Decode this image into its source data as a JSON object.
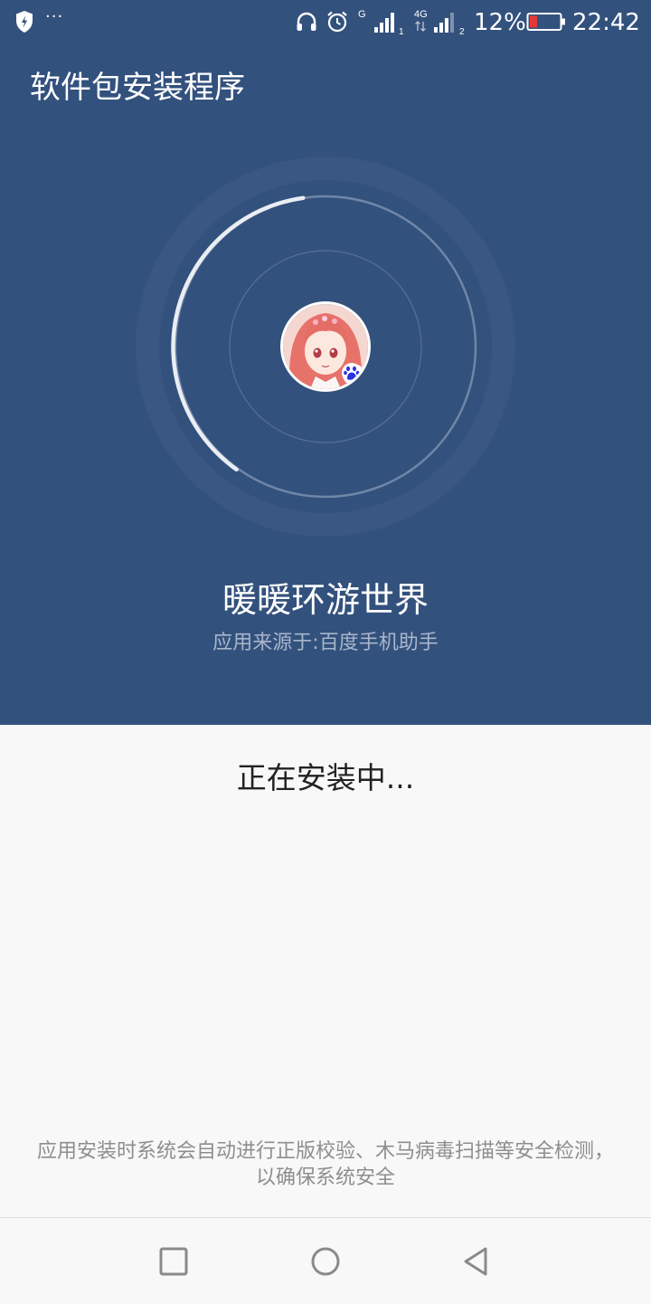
{
  "status_bar": {
    "more_indicator": "···",
    "sim1_network": "G",
    "sim1_slot": "1",
    "sim2_network": "4G",
    "sim2_slot": "2",
    "battery_percent": "12%",
    "battery_level": 0.12,
    "battery_color": "#e53935",
    "time": "22:42",
    "icons": [
      "shield-icon",
      "headphones-icon",
      "alarm-icon",
      "signal-icon",
      "battery-icon"
    ]
  },
  "header": {
    "title": "软件包安装程序"
  },
  "app": {
    "name": "暖暖环游世界",
    "source": "应用来源于:百度手机助手",
    "icon": "anime-girl-app-icon",
    "badge_icon": "baidu-paw-icon"
  },
  "install": {
    "status": "正在安装中...",
    "security_note_line1": "应用安装时系统会自动进行正版校验、木马病毒扫描等安全检测，",
    "security_note_line2": "以确保系统安全"
  },
  "nav": {
    "icons": [
      "recents-icon",
      "home-icon",
      "back-icon"
    ]
  },
  "colors": {
    "primary": "#33517d",
    "background": "#f8f8f8"
  }
}
